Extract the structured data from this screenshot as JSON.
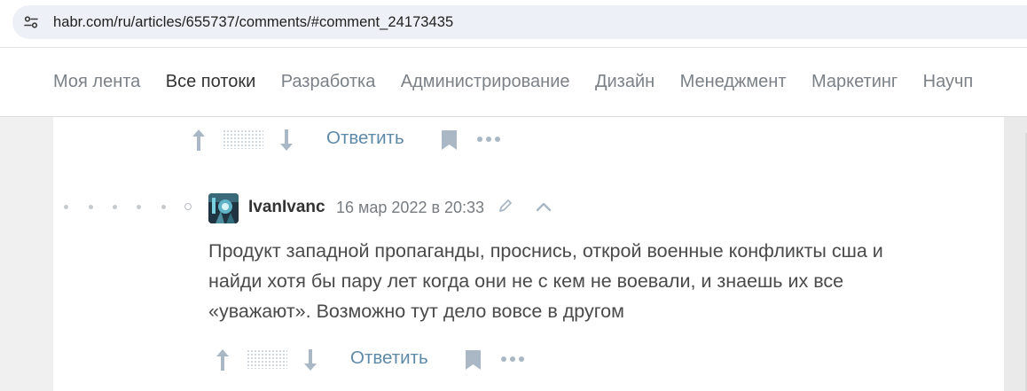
{
  "address_bar": {
    "url": "habr.com/ru/articles/655737/comments/#comment_24173435",
    "site_info_icon": "tune-icon"
  },
  "nav": {
    "items": [
      {
        "label": "Моя лента",
        "active": false
      },
      {
        "label": "Все потоки",
        "active": true
      },
      {
        "label": "Разработка",
        "active": false
      },
      {
        "label": "Администрирование",
        "active": false
      },
      {
        "label": "Дизайн",
        "active": false
      },
      {
        "label": "Менеджмент",
        "active": false
      },
      {
        "label": "Маркетинг",
        "active": false
      },
      {
        "label": "Научп",
        "active": false
      }
    ]
  },
  "prev_comment_actions": {
    "reply_label": "Ответить",
    "icons": [
      "arrow-up-icon",
      "arrow-down-icon",
      "bookmark-icon",
      "more-icon"
    ]
  },
  "comment": {
    "author": "IvanIvanc",
    "date": "16 мар 2022 в 20:33",
    "lines": [
      "Продукт западной пропаганды, проснись, открой военные конфликты сша и",
      "найди хотя бы пару лет когда они не с кем не воевали, и знаешь их все",
      "«уважают». Возможно тут дело вовсе в другом"
    ],
    "reply_label": "Ответить",
    "icons": [
      "arrow-up-icon",
      "arrow-down-icon",
      "bookmark-icon",
      "more-icon",
      "edit-icon",
      "chevron-up-icon"
    ]
  },
  "colors": {
    "link": "#5e8aa8",
    "text": "#4a4a4a",
    "muted": "#777c80",
    "icon": "#a9b8c4"
  }
}
